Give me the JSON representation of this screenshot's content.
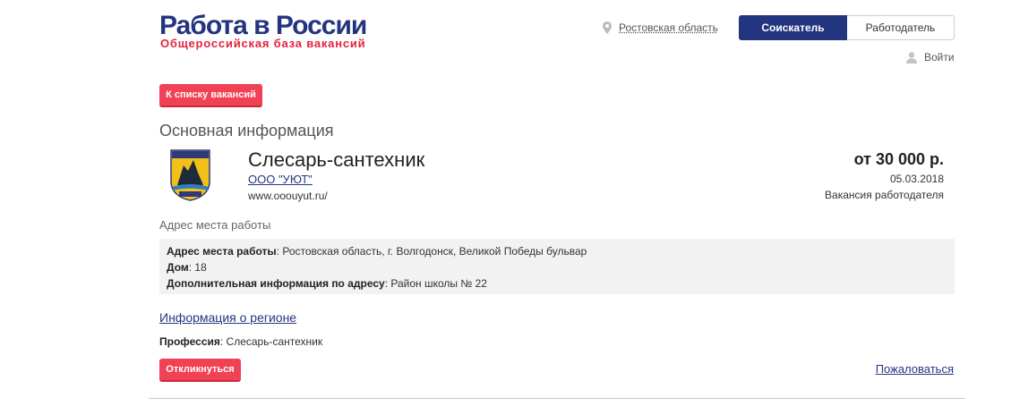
{
  "header": {
    "logo_title": "Работа в России",
    "logo_subtitle": "Общероссийская база вакансий",
    "region": "Ростовская область",
    "role_seeker": "Соискатель",
    "role_employer": "Работодатель",
    "login": "Войти",
    "icons": {
      "region": "location-pin-icon",
      "login": "user-icon"
    }
  },
  "actions": {
    "back_to_list": "К списку вакансий",
    "apply": "Откликнуться",
    "complain": "Пожаловаться"
  },
  "vacancy": {
    "section_title": "Основная информация",
    "title": "Слесарь-сантехник",
    "company": "ООО \"УЮТ\"",
    "company_site": "www.ooouyut.ru/",
    "salary": "от 30 000 р.",
    "date": "05.03.2018",
    "type": "Вакансия работодателя"
  },
  "address": {
    "heading": "Адрес места работы",
    "label_address": "Адрес места работы",
    "value_address": ": Ростовская область, г. Волгодонск, Великой Победы бульвар",
    "label_house": "Дом",
    "value_house": ": 18",
    "label_extra": "Дополнительная информация по адресу",
    "value_extra": ": Район школы № 22"
  },
  "region_info": "Информация о регионе",
  "profession": {
    "label": "Профессия",
    "value": ": Слесарь-сантехник"
  },
  "colors": {
    "brand_blue": "#243580",
    "brand_red": "#e2233d",
    "button_red": "#f04155"
  }
}
